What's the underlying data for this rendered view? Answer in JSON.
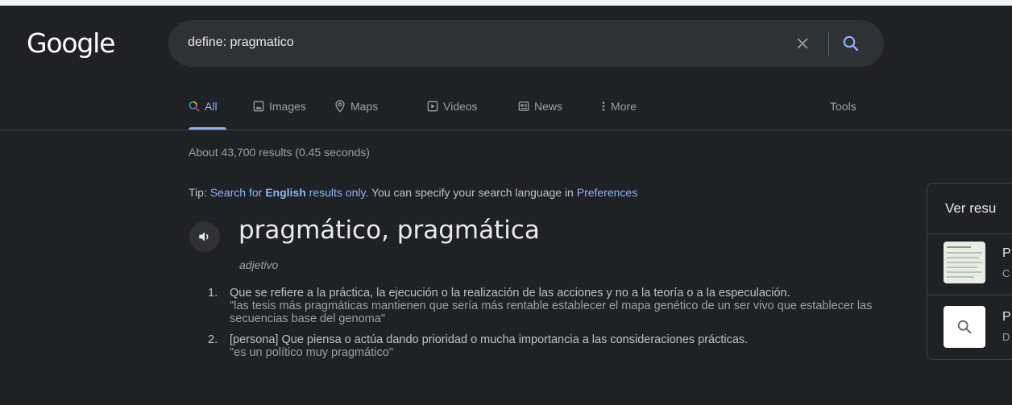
{
  "logo": "Google",
  "search": {
    "value": "define: pragmatico"
  },
  "tabs": [
    {
      "label": "All",
      "icon": "search-icon"
    },
    {
      "label": "Images",
      "icon": "image-icon"
    },
    {
      "label": "Maps",
      "icon": "map-pin-icon"
    },
    {
      "label": "Videos",
      "icon": "play-icon"
    },
    {
      "label": "News",
      "icon": "news-icon"
    },
    {
      "label": "More",
      "icon": "more-vert-icon"
    }
  ],
  "tools_label": "Tools",
  "stats": "About 43,700 results (0.45 seconds)",
  "tip": {
    "prefix": "Tip: ",
    "link1_pre": "Search for ",
    "link1_bold": "English",
    "link1_post": " results only",
    "middle": ". You can specify your search language in ",
    "link2": "Preferences"
  },
  "dictionary": {
    "headword": "pragmático, pragmática",
    "part_of_speech": "adjetivo",
    "definitions": [
      {
        "num": "1.",
        "text": "Que se refiere a la práctica, la ejecución o la realización de las acciones y no a la teoría o a la especulación.",
        "example": "\"las tesis más pragmáticas mantienen que sería más rentable establecer el mapa genético de un ser vivo que establecer las secuencias base del genoma\""
      },
      {
        "num": "2.",
        "text": "[persona] Que piensa o actúa dando prioridad o mucha importancia a las consideraciones prácticas.",
        "example": "\"es un político muy pragmático\""
      }
    ]
  },
  "side_panel": {
    "title": "Ver resu",
    "items": [
      {
        "line1": "P",
        "line2": "C"
      },
      {
        "line1": "P",
        "line2": "D"
      }
    ]
  },
  "colors": {
    "background": "#202124",
    "link": "#8ab4f8",
    "text": "#bdc1c6"
  }
}
